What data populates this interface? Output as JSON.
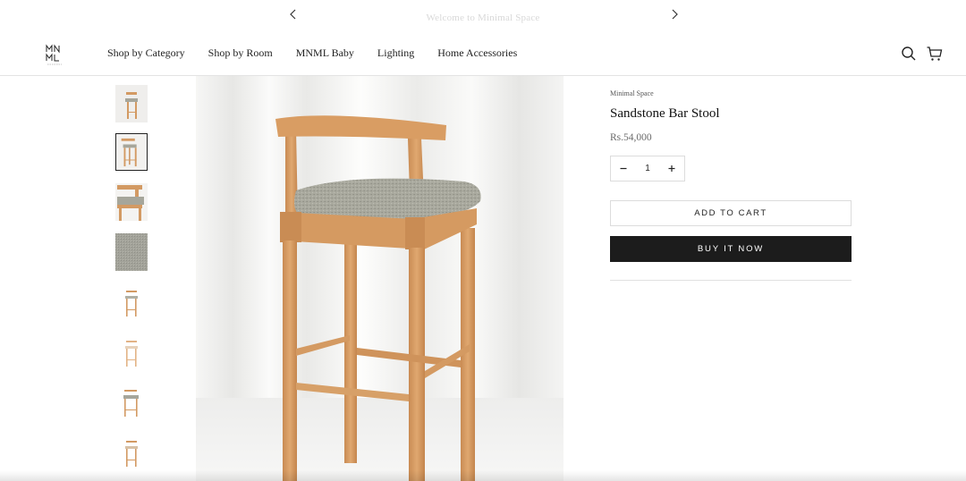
{
  "announcement": {
    "message": "Welcome to Minimal Space",
    "prev_icon": "chevron-left-icon",
    "next_icon": "chevron-right-icon"
  },
  "header": {
    "logo_text": "MNML SPACE",
    "nav": [
      {
        "label": "Shop by Category"
      },
      {
        "label": "Shop by Room"
      },
      {
        "label": "MNML Baby"
      },
      {
        "label": "Lighting"
      },
      {
        "label": "Home Accessories"
      }
    ],
    "icons": [
      "search-icon",
      "cart-icon"
    ]
  },
  "gallery": {
    "thumbnail_count": 8,
    "active_index": 1
  },
  "product": {
    "vendor": "Minimal Space",
    "title": "Sandstone Bar Stool",
    "price": "Rs.54,000",
    "quantity": "1",
    "add_to_cart_label": "ADD TO CART",
    "buy_now_label": "BUY IT NOW"
  },
  "colors": {
    "wood": "#D9A06A",
    "seat_fabric": "#A9A99E",
    "buy_button": "#1C1C1C"
  }
}
